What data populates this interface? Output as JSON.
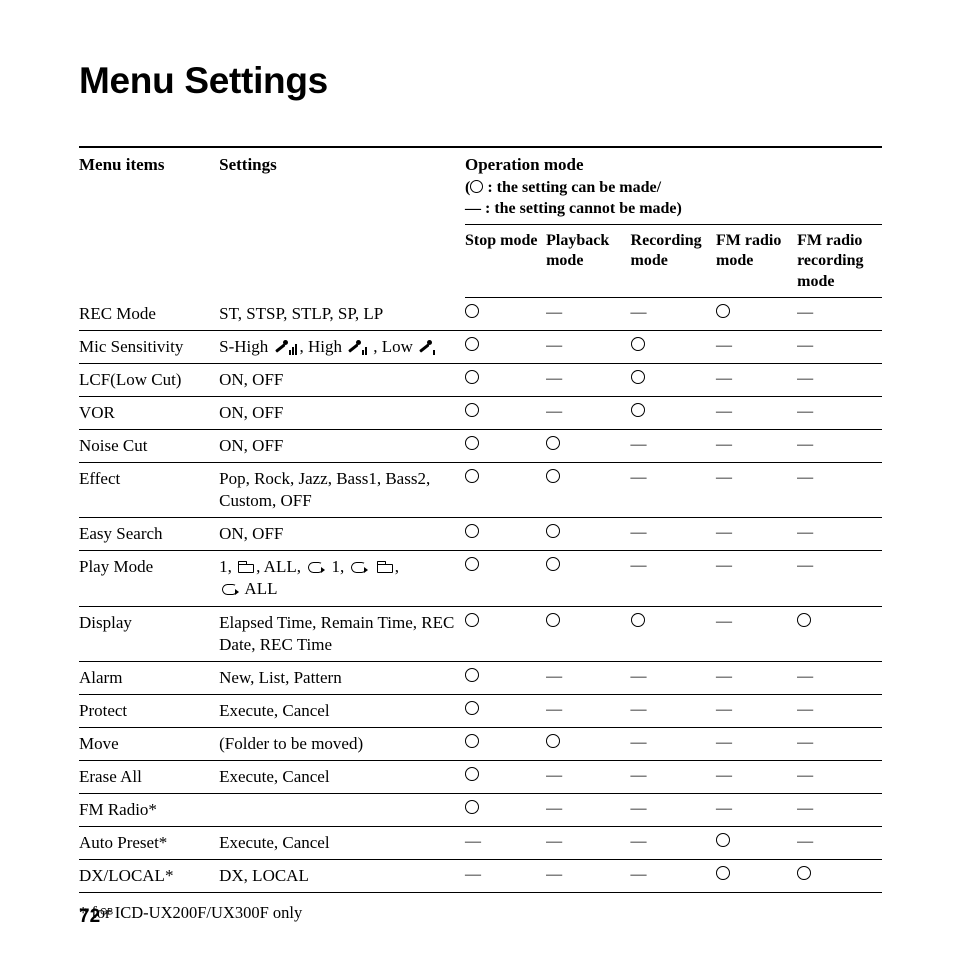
{
  "title": "Menu Settings",
  "headers": {
    "menu_items": "Menu items",
    "settings": "Settings",
    "operation_mode": "Operation mode",
    "op_note_yes": " : the setting can be made/",
    "op_note_no": "— : the setting cannot be made",
    "modes": {
      "stop": "Stop mode",
      "playback": "Playback mode",
      "recording": "Recording mode",
      "fm": "FM radio mode",
      "fm_rec": "FM radio recording mode"
    }
  },
  "rows": [
    {
      "item": "REC Mode",
      "setting_type": "text",
      "setting": "ST, STSP, STLP, SP, LP",
      "marks": [
        "O",
        "—",
        "—",
        "O",
        "—"
      ]
    },
    {
      "item": "Mic Sensitivity",
      "setting_type": "mic",
      "marks": [
        "O",
        "—",
        "O",
        "—",
        "—"
      ]
    },
    {
      "item": "LCF(Low Cut)",
      "setting_type": "text",
      "setting": "ON, OFF",
      "marks": [
        "O",
        "—",
        "O",
        "—",
        "—"
      ]
    },
    {
      "item": "VOR",
      "setting_type": "text",
      "setting": "ON, OFF",
      "marks": [
        "O",
        "—",
        "O",
        "—",
        "—"
      ]
    },
    {
      "item": "Noise Cut",
      "setting_type": "text",
      "setting": "ON, OFF",
      "marks": [
        "O",
        "O",
        "—",
        "—",
        "—"
      ]
    },
    {
      "item": "Effect",
      "setting_type": "text",
      "setting": "Pop, Rock, Jazz, Bass1, Bass2, Custom, OFF",
      "marks": [
        "O",
        "O",
        "—",
        "—",
        "—"
      ]
    },
    {
      "item": "Easy Search",
      "setting_type": "text",
      "setting": "ON, OFF",
      "marks": [
        "O",
        "O",
        "—",
        "—",
        "—"
      ]
    },
    {
      "item": "Play Mode",
      "setting_type": "playmode",
      "marks": [
        "O",
        "O",
        "—",
        "—",
        "—"
      ]
    },
    {
      "item": "Display",
      "setting_type": "text",
      "setting": "Elapsed Time, Remain Time, REC Date, REC Time",
      "marks": [
        "O",
        "O",
        "O",
        "—",
        "O"
      ]
    },
    {
      "item": "Alarm",
      "setting_type": "text",
      "setting": "New, List, Pattern",
      "marks": [
        "O",
        "—",
        "—",
        "—",
        "—"
      ]
    },
    {
      "item": "Protect",
      "setting_type": "text",
      "setting": "Execute, Cancel",
      "marks": [
        "O",
        "—",
        "—",
        "—",
        "—"
      ]
    },
    {
      "item": "Move",
      "setting_type": "text",
      "setting": "(Folder to be moved)",
      "marks": [
        "O",
        "O",
        "—",
        "—",
        "—"
      ]
    },
    {
      "item": "Erase All",
      "setting_type": "text",
      "setting": "Execute, Cancel",
      "marks": [
        "O",
        "—",
        "—",
        "—",
        "—"
      ]
    },
    {
      "item": "FM Radio*",
      "setting_type": "text",
      "setting": "",
      "marks": [
        "O",
        "—",
        "—",
        "—",
        "—"
      ]
    },
    {
      "item": "Auto Preset*",
      "setting_type": "text",
      "setting": "Execute, Cancel",
      "marks": [
        "—",
        "—",
        "—",
        "O",
        "—"
      ]
    },
    {
      "item": "DX/LOCAL*",
      "setting_type": "text",
      "setting": "DX, LOCAL",
      "marks": [
        "—",
        "—",
        "—",
        "O",
        "O"
      ]
    }
  ],
  "mic_labels": {
    "shigh": "S-High",
    "high": "High",
    "low": "Low"
  },
  "playmode_labels": {
    "one": "1",
    "all": "ALL",
    "r1": "1",
    "rall": "ALL"
  },
  "footnote": "* for ICD-UX200F/UX300F only",
  "page_number": "72",
  "page_number_suffix": "GB"
}
